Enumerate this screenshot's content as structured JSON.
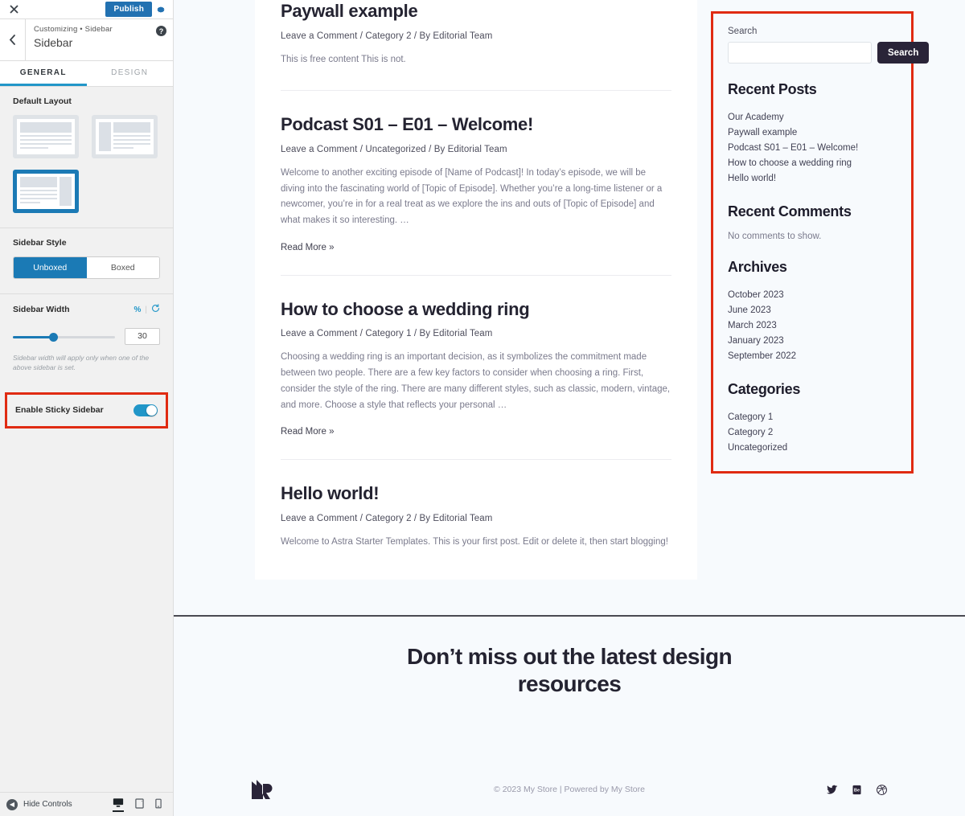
{
  "customizer": {
    "topbar": {
      "close_icon": "close-icon",
      "publish_label": "Publish",
      "gear_icon": "gear-icon"
    },
    "header": {
      "back_icon": "chevron-left-icon",
      "breadcrumb": "Customizing • Sidebar",
      "title": "Sidebar",
      "help_label": "?"
    },
    "tabs": [
      {
        "label": "GENERAL",
        "active": true
      },
      {
        "label": "DESIGN",
        "active": false
      }
    ],
    "default_layout": {
      "label": "Default Layout",
      "options": [
        {
          "name": "no-sidebar",
          "selected": false
        },
        {
          "name": "left-sidebar",
          "selected": false
        },
        {
          "name": "right-sidebar",
          "selected": true
        }
      ]
    },
    "sidebar_style": {
      "label": "Sidebar Style",
      "options": [
        {
          "label": "Unboxed",
          "active": true
        },
        {
          "label": "Boxed",
          "active": false
        }
      ]
    },
    "sidebar_width": {
      "label": "Sidebar Width",
      "unit": "%",
      "reset_icon": "reset-icon",
      "value": "30",
      "slider_percent": 40,
      "note": "Sidebar width will apply only when one of the above sidebar is set."
    },
    "sticky_sidebar": {
      "label": "Enable Sticky Sidebar",
      "enabled": true,
      "highlight_color": "#e02b12"
    },
    "footer": {
      "hide_controls_label": "Hide Controls",
      "devices": [
        {
          "name": "desktop-icon",
          "active": true
        },
        {
          "name": "tablet-icon",
          "active": false
        },
        {
          "name": "mobile-icon",
          "active": false
        }
      ]
    },
    "accent_color": "#2271b1",
    "select_color": "#1b7ab5"
  },
  "preview": {
    "posts": [
      {
        "title": "Paywall example",
        "meta": "Leave a Comment / Category 2 / By Editorial Team",
        "excerpt": "This is free content This is not.",
        "read_more": ""
      },
      {
        "title": "Podcast S01 – E01 – Welcome!",
        "meta": "Leave a Comment / Uncategorized / By Editorial Team",
        "excerpt": "Welcome to another exciting episode of [Name of Podcast]! In today’s episode, we will be diving into the fascinating world of [Topic of Episode]. Whether you’re a long-time listener or a newcomer, you’re in for a real treat as we explore the ins and outs of [Topic of Episode] and what makes it so interesting. …",
        "read_more": "Read More »"
      },
      {
        "title": "How to choose a wedding ring",
        "meta": "Leave a Comment / Category 1 / By Editorial Team",
        "excerpt": "Choosing a wedding ring is an important decision, as it symbolizes the commitment made between two people. There are a few key factors to consider when choosing a ring. First, consider the style of the ring. There are many different styles, such as classic, modern, vintage, and more. Choose a style that reflects your personal …",
        "read_more": "Read More »"
      },
      {
        "title": "Hello world!",
        "meta": "Leave a Comment / Category 2 / By Editorial Team",
        "excerpt": "Welcome to Astra Starter Templates. This is your first post. Edit or delete it, then start blogging!",
        "read_more": ""
      }
    ],
    "widgets": {
      "search": {
        "title": "Search",
        "input_value": "",
        "input_placeholder": "",
        "button_label": "Search",
        "button_color": "#2a2438"
      },
      "recent_posts": {
        "heading": "Recent Posts",
        "items": [
          "Our Academy",
          "Paywall example",
          "Podcast S01 – E01 – Welcome!",
          "How to choose a wedding ring",
          "Hello world!"
        ]
      },
      "recent_comments": {
        "heading": "Recent Comments",
        "empty_text": "No comments to show."
      },
      "archives": {
        "heading": "Archives",
        "items": [
          "October 2023",
          "June 2023",
          "March 2023",
          "January 2023",
          "September 2022"
        ]
      },
      "categories": {
        "heading": "Categories",
        "items": [
          "Category 1",
          "Category 2",
          "Uncategorized"
        ]
      },
      "highlight_color": "#e02b12"
    },
    "cta_heading": "Don’t miss out the latest design resources",
    "footer": {
      "logo_name": "mr-monogram-logo",
      "copyright": "© 2023 My Store | Powered by My Store",
      "social": [
        {
          "name": "twitter-icon"
        },
        {
          "name": "behance-icon"
        },
        {
          "name": "dribbble-icon"
        }
      ]
    }
  }
}
